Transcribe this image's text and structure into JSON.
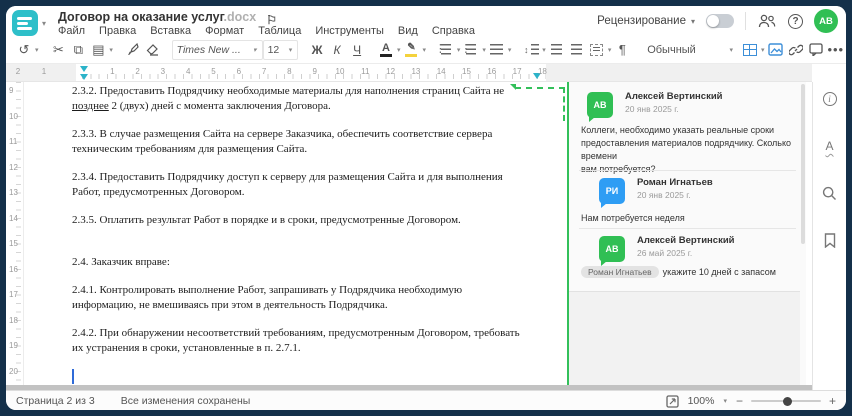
{
  "colors": {
    "accent_teal": "#2ebfc9",
    "comment_green": "#30bf54",
    "comment_blue": "#2e9df4",
    "anchor_green": "#33c05a",
    "toolbar_blue": "#3d8fd8"
  },
  "header": {
    "doc_title": "Договор на оказание услуг",
    "doc_extension": ".docx",
    "menu_items": [
      "Файл",
      "Правка",
      "Вставка",
      "Формат",
      "Таблица",
      "Инструменты",
      "Вид",
      "Справка"
    ],
    "review_mode_label": "Рецензирование",
    "avatar_initials": "АВ"
  },
  "toolbar": {
    "font_name": "Times New ...",
    "font_size": "12",
    "bold_label": "Ж",
    "italic_label": "К",
    "underline_label": "Ч",
    "font_color_label": "А",
    "style_name": "Обычный"
  },
  "ruler": {
    "h_margin_numbers": [
      "2",
      "1"
    ],
    "h_numbers": [
      "1",
      "2",
      "3",
      "4",
      "5",
      "6",
      "7",
      "8",
      "9",
      "10",
      "11",
      "12",
      "13",
      "14",
      "15",
      "16",
      "17",
      "18"
    ],
    "v_numbers": [
      "9",
      "10",
      "11",
      "12",
      "13",
      "14",
      "15",
      "16",
      "17",
      "18",
      "19",
      "20"
    ]
  },
  "document": {
    "paragraphs": [
      {
        "prefix": "2.3.2. Предоставить Подрядчику необходимые материалы для наполнения страниц Сайта не\n",
        "underlined": "позднее",
        "suffix": " 2 (двух) дней с момента заключения Договора."
      },
      {
        "text": "2.3.3. В случае размещения Сайта на сервере Заказчика, обеспечить соответствие сервера\nтехническим требованиям для размещения Сайта."
      },
      {
        "text": "2.3.4. Предоставить Подрядчику доступ к серверу для размещения Сайта и для выполнения\nРабот, предусмотренных Договором."
      },
      {
        "text": "2.3.5. Оплатить результат Работ в порядке и в сроки, предусмотренные Договором."
      },
      {
        "text": "2.4. Заказчик вправе:"
      },
      {
        "text": "2.4.1. Контролировать выполнение Работ, запрашивать у Подрядчика необходимую\nинформацию, не вмешиваясь при этом в деятельность Подрядчика."
      },
      {
        "text": "2.4.2. При обнаружении несоответствий требованиям, предусмотренным Договором, требовать\nих устранения в сроки, установленные в п. 2.7.1."
      }
    ]
  },
  "comments": {
    "thread": [
      {
        "initials": "АВ",
        "name": "Алексей Вертинский",
        "date": "20 янв 2025 г.",
        "text": "Коллеги, необходимо указать реальные сроки\nпредоставления материалов подрядчику. Сколько времени\nвам потребуется?"
      },
      {
        "initials": "РИ",
        "name": "Роман Игнатьев",
        "date": "20 янв 2025 г.",
        "text": "Нам потребуется неделя"
      },
      {
        "initials": "АВ",
        "name": "Алексей Вертинский",
        "date": "26 май 2025 г.",
        "mention": "Роман Игнатьев",
        "text": "укажите 10 дней с запасом"
      }
    ]
  },
  "statusbar": {
    "page_info": "Страница 2 из 3",
    "save_status": "Все изменения сохранены",
    "zoom_value": "100%"
  }
}
